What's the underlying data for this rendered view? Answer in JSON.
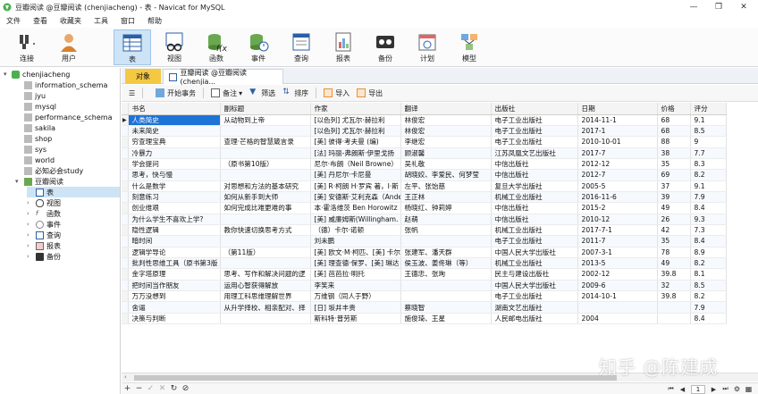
{
  "window": {
    "title": "豆瓣阅读 @豆瓣阅读 (chenjiacheng) - 表 - Navicat for MySQL",
    "controls": [
      "minimize",
      "restore",
      "close"
    ]
  },
  "menu": [
    "文件",
    "查看",
    "收藏夹",
    "工具",
    "窗口",
    "帮助"
  ],
  "toolbar": [
    {
      "label": "连接",
      "icon": "connection-icon"
    },
    {
      "label": "用户",
      "icon": "user-icon"
    },
    {
      "label": "表",
      "icon": "table-icon",
      "active": true
    },
    {
      "label": "视图",
      "icon": "view-icon"
    },
    {
      "label": "函数",
      "icon": "function-icon"
    },
    {
      "label": "事件",
      "icon": "event-icon"
    },
    {
      "label": "查询",
      "icon": "query-icon"
    },
    {
      "label": "报表",
      "icon": "report-icon"
    },
    {
      "label": "备份",
      "icon": "backup-icon"
    },
    {
      "label": "计划",
      "icon": "schedule-icon"
    },
    {
      "label": "模型",
      "icon": "model-icon"
    }
  ],
  "sidebar": {
    "connection": "chenjiacheng",
    "databases": [
      "information_schema",
      "jyu",
      "mysql",
      "performance_schema",
      "sakila",
      "shop",
      "sys",
      "world",
      "必知必会study"
    ],
    "open_db": "豆瓣阅读",
    "objects": [
      "表",
      "视图",
      "函数",
      "事件",
      "查询",
      "报表",
      "备份"
    ]
  },
  "tabs": {
    "objects": "对象",
    "data_tab": "豆瓣阅读 @豆瓣阅读 (chenjia..."
  },
  "subtoolbar": {
    "begin_tx": "开始事务",
    "memo": "备注",
    "filter": "筛选",
    "sort": "排序",
    "import": "导入",
    "export": "导出"
  },
  "grid": {
    "columns": [
      "书名",
      "副标题",
      "作家",
      "翻译",
      "出版社",
      "日期",
      "价格",
      "评分"
    ],
    "rows": [
      [
        "人类简史",
        "从动物到上帝",
        "[以色列] 尤瓦尔·赫拉利",
        "林俊宏",
        "电子工业出版社",
        "2014-11-1",
        "68",
        "9.1"
      ],
      [
        "未来简史",
        "",
        "[以色列] 尤瓦尔·赫拉利",
        "林俊宏",
        "电子工业出版社",
        "2017-1",
        "68",
        "8.5"
      ],
      [
        "穷查理宝典",
        "查理·芒格的智慧箴言录",
        "[美] 彼得·考夫曼 (编)",
        "李继宏",
        "电子工业出版社",
        "2010-10-01",
        "88",
        "9"
      ],
      [
        "冷暴力",
        "",
        "[法] 玛丽-弗朗斯·伊里戈扬",
        "顾淑馨",
        "江苏凤凰文艺出版社",
        "2017-7",
        "38",
        "7.7"
      ],
      [
        "学会提问",
        "（原书第10版）",
        "尼尔·布朗（Neil Browne）",
        "吴礼敬",
        "中信出版社",
        "2012-12",
        "35",
        "8.3"
      ],
      [
        "思考，快与慢",
        "",
        "[美] 丹尼尔·卡尼曼",
        "胡晓姣、李爱民、何梦莹",
        "中信出版社",
        "2012-7",
        "69",
        "8.2"
      ],
      [
        "什么是数学",
        "对思想和方法的基本研究",
        "[美] R·柯朗 H·罗宾 著，I·斯",
        "左平、张饴慈",
        "复旦大学出版社",
        "2005-5",
        "37",
        "9.1"
      ],
      [
        "刻意练习",
        "如何从新手到大师",
        "[美] 安德斯·艾利克森（Ande",
        "王正林",
        "机械工业出版社",
        "2016-11-6",
        "39",
        "7.9"
      ],
      [
        "创业维艰",
        "如何完成比难更难的事",
        "本·霍洛维茨 Ben Horowitz",
        "杨晓红、钟莉婷",
        "中信出版社",
        "2015-2",
        "49",
        "8.4"
      ],
      [
        "为什么学生不喜欢上学?",
        "",
        "[美] 威廉姆斯(Willingham.",
        "赵萌",
        "中信出版社",
        "2010-12",
        "26",
        "9.3"
      ],
      [
        "隐性逻辑",
        "教你快速切换思考方式",
        "（德）卡尔·诺顿",
        "张帆",
        "机械工业出版社",
        "2017-7-1",
        "42",
        "7.3"
      ],
      [
        "暗时间",
        "",
        "刘未鹏",
        "",
        "电子工业出版社",
        "2011-7",
        "35",
        "8.4"
      ],
      [
        "逻辑学导论",
        "（第11版）",
        "[美] 欧文·M·柯匹、[美] 卡尔",
        "张建军、潘天群",
        "中国人民大学出版社",
        "2007-3-1",
        "78",
        "8.9"
      ],
      [
        "批判性思维工具（原书第3版",
        "",
        "[美] 理查德·保罗、[美] 琳达",
        "侯玉波、姜佟琳（等）",
        "机械工业出版社",
        "2013-5",
        "49",
        "8.2"
      ],
      [
        "金字塔原理",
        "思考、写作和解决问题的逻",
        "[美] 芭芭拉·明托",
        "王德忠、张珣",
        "民主与建设出版社",
        "2002-12",
        "39.8",
        "8.1"
      ],
      [
        "把时间当作朋友",
        "运用心智获得解放",
        "李笑来",
        "",
        "中国人民大学出版社",
        "2009-6",
        "32",
        "8.5"
      ],
      [
        "万万没想到",
        "用理工科思维理解世界",
        "万维钢（同人于野）",
        "",
        "电子工业出版社",
        "2014-10-1",
        "39.8",
        "8.2"
      ],
      [
        "舍逼",
        "从升学择校、相亲配对、择",
        "[日] 坂井丰贵",
        "蔡晓智",
        "湖南文艺出版社",
        "",
        "",
        "7.9"
      ],
      [
        "决策与判断",
        "",
        "斯科特·普劳斯",
        "施俊琦、王星",
        "人民邮电出版社",
        "2004",
        "",
        "8.4"
      ]
    ],
    "row_marker": "▶"
  },
  "footer": {
    "page": "1"
  },
  "watermark": "知乎 @陈建成"
}
